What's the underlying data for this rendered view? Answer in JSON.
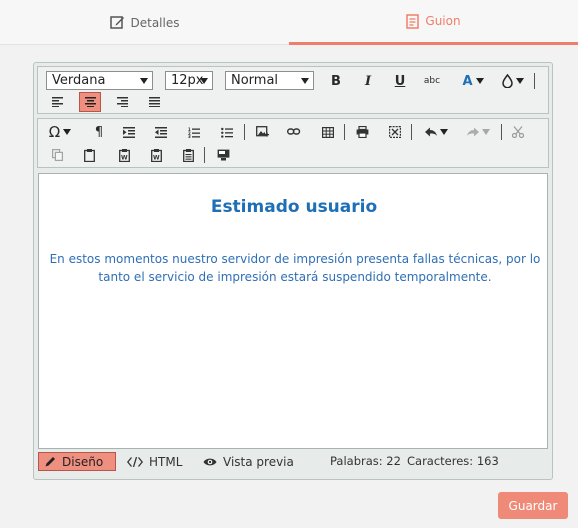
{
  "tabs": {
    "details": "Detalles",
    "script": "Guion"
  },
  "toolbar": {
    "font_family": "Verdana",
    "font_size": "12px",
    "paragraph_format": "Normal",
    "bold": "B",
    "italic": "I",
    "underline": "U",
    "strikethrough": "abc",
    "text_color": "A",
    "special_chars": "Ω",
    "paragraph_mark": "¶"
  },
  "editor": {
    "heading": "Estimado usuario",
    "body": "En estos momentos nuestro servidor de impresión presenta fallas técnicas, por lo tanto el servicio de impresión estará suspendido temporalmente."
  },
  "modes": {
    "design": "Diseño",
    "html": "HTML",
    "preview": "Vista previa"
  },
  "stats": {
    "words": "Palabras: 22",
    "chars": "Caracteres: 163"
  },
  "actions": {
    "save": "Guardar"
  },
  "colors": {
    "accent": "#ef7e6a",
    "heading": "#1e6fb5"
  }
}
